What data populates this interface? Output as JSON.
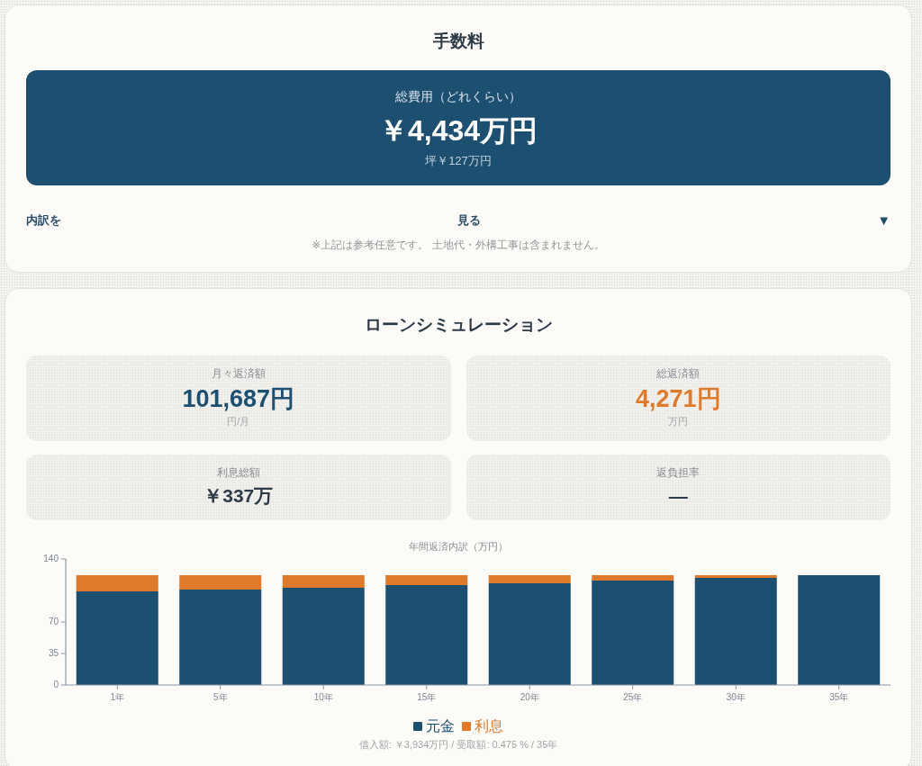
{
  "fee_card": {
    "title": "手数料",
    "total": {
      "label": "総費用（どれくらい）",
      "value": "￥4,434万円",
      "per_tsubo": "坪￥127万円"
    },
    "breakdown_toggle": {
      "label_start": "内訳を",
      "label_end": "見る",
      "icon": "▼",
      "expanded": false
    },
    "note": "※上記は参考任意です。 土地代・外構工事は含まれません。"
  },
  "loan_simulation": {
    "title": "ローンシミュレーション",
    "stats": [
      {
        "kind": "primary",
        "label": "月々返済額",
        "value": "101,687円",
        "unit": "円/月",
        "color": "#1c4f70"
      },
      {
        "kind": "primary",
        "label": "総返済額",
        "value": "4,271円",
        "unit": "万円",
        "color": "#e07a2b"
      },
      {
        "kind": "secondary",
        "label": "利息総額",
        "value": "￥337万",
        "color": "#2d3a48"
      },
      {
        "kind": "secondary",
        "label": "返負担率",
        "value": "—",
        "color": "#2d3a48"
      }
    ],
    "chart_data": {
      "type": "bar",
      "title": "年間返済内訳（万円）",
      "categories": [
        "1年",
        "5年",
        "10年",
        "15年",
        "20年",
        "25年",
        "30年",
        "35年"
      ],
      "series": [
        {
          "name": "元金",
          "color": "#1c4f70",
          "values": [
            104,
            106,
            108,
            111,
            113,
            116,
            119,
            122
          ]
        },
        {
          "name": "利息",
          "color": "#e07a2b",
          "values": [
            18,
            16,
            14,
            11,
            9,
            6,
            3,
            0
          ]
        }
      ],
      "stacked": true,
      "ylim": [
        0,
        140
      ],
      "yticks": [
        0,
        35,
        70,
        140
      ]
    },
    "footnote": "借入額: ￥3,934万円 / 受取額: 0.475 % / 35年"
  }
}
